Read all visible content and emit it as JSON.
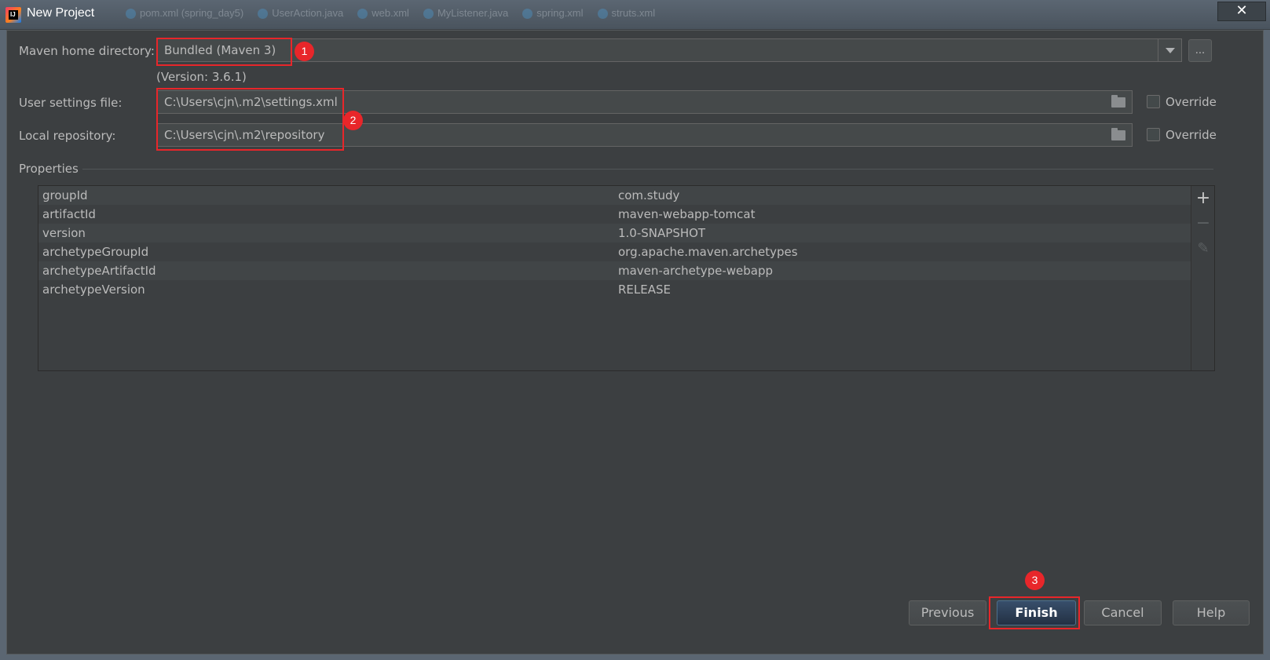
{
  "window": {
    "title": "New Project",
    "close_glyph": "✕",
    "background_tabs": [
      "pom.xml (spring_day5)",
      "UserAction.java",
      "web.xml",
      "MyListener.java",
      "spring.xml",
      "struts.xml"
    ]
  },
  "maven": {
    "home_label": "Maven home directory:",
    "home_value": "Bundled (Maven 3)",
    "browse_label": "...",
    "version_text": "(Version: 3.6.1)",
    "settings_label": "User settings file:",
    "settings_value": "C:\\Users\\cjn\\.m2\\settings.xml",
    "settings_override": "Override",
    "repo_label": "Local repository:",
    "repo_value": "C:\\Users\\cjn\\.m2\\repository",
    "repo_override": "Override"
  },
  "properties": {
    "title": "Properties",
    "rows": [
      {
        "key": "groupId",
        "value": "com.study"
      },
      {
        "key": "artifactId",
        "value": "maven-webapp-tomcat"
      },
      {
        "key": "version",
        "value": "1.0-SNAPSHOT"
      },
      {
        "key": "archetypeGroupId",
        "value": "org.apache.maven.archetypes"
      },
      {
        "key": "archetypeArtifactId",
        "value": "maven-archetype-webapp"
      },
      {
        "key": "archetypeVersion",
        "value": "RELEASE"
      }
    ],
    "tools": {
      "add": "+",
      "remove": "−",
      "edit": "✎"
    }
  },
  "annotations": {
    "one": "1",
    "two": "2",
    "three": "3",
    "color": "#e8262a"
  },
  "footer": {
    "previous": "Previous",
    "finish": "Finish",
    "cancel": "Cancel",
    "help": "Help"
  }
}
